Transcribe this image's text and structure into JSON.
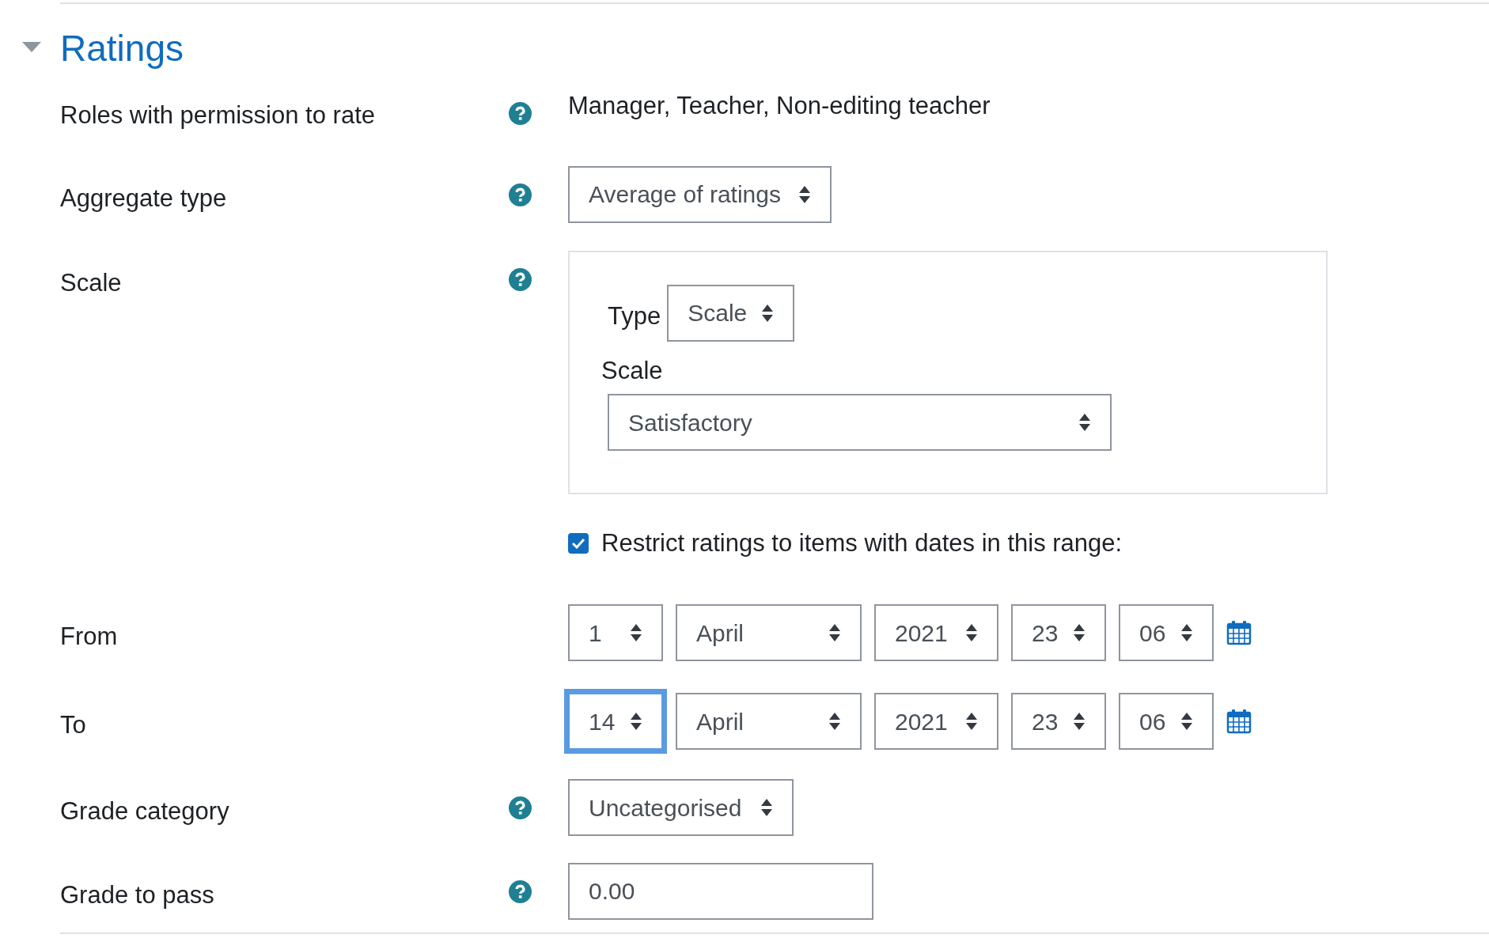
{
  "section": {
    "title": "Ratings",
    "expanded": true
  },
  "rows": [
    {
      "kind": "static",
      "label": "Roles with permission to rate",
      "help": true,
      "value": "Manager, Teacher, Non-editing teacher"
    },
    {
      "kind": "select",
      "label": "Aggregate type",
      "help": true,
      "value": "Average of ratings"
    },
    {
      "kind": "scale",
      "label": "Scale",
      "help": true,
      "type_label": "Type",
      "type_value": "Scale",
      "scale_label": "Scale",
      "scale_value": "Satisfactory"
    },
    {
      "kind": "checkbox",
      "text": "Restrict ratings to items with dates in this range:",
      "checked": true
    },
    {
      "kind": "date",
      "label": "From",
      "fields": [
        {
          "value": "1",
          "focused": false
        },
        {
          "value": "April",
          "focused": false
        },
        {
          "value": "2021",
          "focused": false
        },
        {
          "value": "23",
          "focused": false
        },
        {
          "value": "06",
          "focused": false
        }
      ]
    },
    {
      "kind": "date",
      "label": "To",
      "fields": [
        {
          "value": "14",
          "focused": true
        },
        {
          "value": "April",
          "focused": false
        },
        {
          "value": "2021",
          "focused": false
        },
        {
          "value": "23",
          "focused": false
        },
        {
          "value": "06",
          "focused": false
        }
      ]
    },
    {
      "kind": "select",
      "label": "Grade category",
      "help": true,
      "value": "Uncategorised"
    },
    {
      "kind": "text",
      "label": "Grade to pass",
      "help": true,
      "value": "0.00"
    }
  ]
}
